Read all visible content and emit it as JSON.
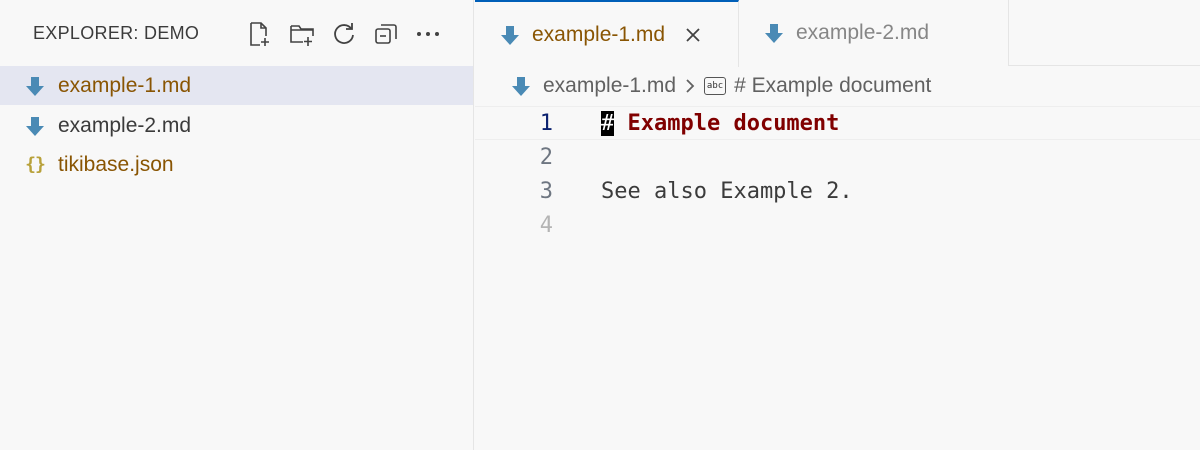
{
  "sidebar": {
    "title": "EXPLORER: DEMO",
    "actions": [
      {
        "name": "new-file-icon"
      },
      {
        "name": "new-folder-icon"
      },
      {
        "name": "refresh-icon"
      },
      {
        "name": "collapse-all-icon"
      },
      {
        "name": "more-actions-icon"
      }
    ],
    "files": [
      {
        "label": "example-1.md",
        "icon": "markdown-icon",
        "selected": true,
        "modified": true
      },
      {
        "label": "example-2.md",
        "icon": "markdown-icon",
        "selected": false,
        "modified": false
      },
      {
        "label": "tikibase.json",
        "icon": "json-icon",
        "icon_text": "{}",
        "selected": false,
        "modified": true
      }
    ]
  },
  "tabs": [
    {
      "label": "example-1.md",
      "active": true,
      "close_icon": "close-icon"
    },
    {
      "label": "example-2.md",
      "active": false
    }
  ],
  "breadcrumb": {
    "file": "example-1.md",
    "symbol": "# Example document",
    "symbol_icon_text": "abc"
  },
  "editor": {
    "lines": [
      {
        "number": "1",
        "hash": "#",
        "heading": " Example document"
      },
      {
        "number": "2",
        "text": ""
      },
      {
        "number": "3",
        "text": "See also Example 2."
      },
      {
        "number": "4",
        "text": ""
      }
    ]
  },
  "colors": {
    "accent": "#005fb8",
    "markdown_icon": "#4a8ab5",
    "modified_text": "#895503",
    "heading": "#800000",
    "selection_bg": "#e4e6f1"
  }
}
